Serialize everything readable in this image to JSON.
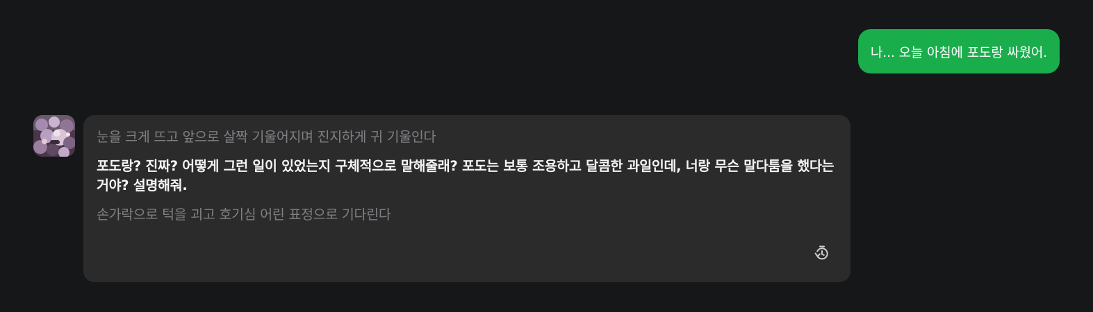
{
  "user_message": {
    "text": "나... 오늘 아침에 포도랑 싸웠어."
  },
  "bot_message": {
    "avatar_icon": "character-avatar",
    "action_before": "눈을 크게 뜨고 앞으로 살짝 기울어지며 진지하게 귀 기울인다",
    "dialogue": "포도랑? 진짜? 어떻게 그런 일이 있었는지 구체적으로 말해줄래? 포도는 보통 조용하고 달콤한 과일인데, 너랑 무슨 말다툼을 했다는 거야? 설명해줘.",
    "action_after": "손가락으로 턱을 괴고 호기심 어린 표정으로 기다린다",
    "regenerate_icon": "regenerate-history-icon"
  },
  "colors": {
    "background": "#161719",
    "user_bubble": "#1aad4c",
    "bot_card": "#2b2b2c",
    "action_text": "#7f8083",
    "dialogue_text": "#f5f5f5"
  }
}
